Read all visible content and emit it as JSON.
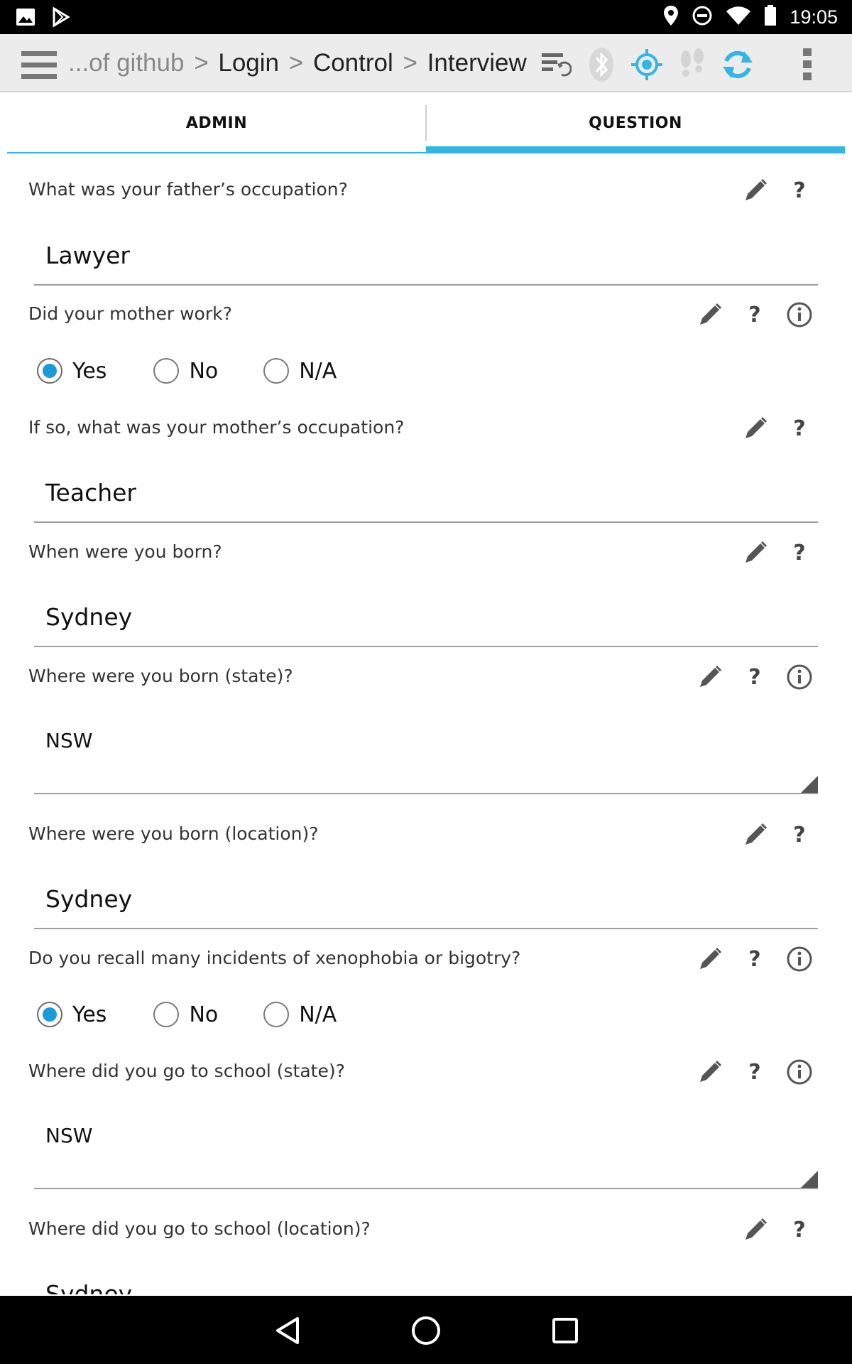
{
  "status_bar": {
    "time": "19:05",
    "icons": [
      "image-icon",
      "play-store-icon",
      "location-icon",
      "do-not-disturb-icon",
      "wifi-icon",
      "battery-icon"
    ]
  },
  "action_bar": {
    "breadcrumb_prefix": "...of github",
    "breadcrumb_sep": ">",
    "crumbs": [
      "Login",
      "Control",
      "Interview"
    ],
    "icons": [
      "sync-settings-icon",
      "bluetooth-icon",
      "gps-icon",
      "footsteps-icon",
      "refresh-icon",
      "overflow-menu-icon"
    ],
    "accent_color": "#33b5e5"
  },
  "tabs": [
    {
      "label": "ADMIN",
      "selected": false
    },
    {
      "label": "QUESTION",
      "selected": true
    }
  ],
  "questions": [
    {
      "label": "What was your father’s occupation?",
      "type": "text",
      "value": "Lawyer",
      "info": false
    },
    {
      "label": "Did your mother work?",
      "type": "radio",
      "options": [
        "Yes",
        "No",
        "N/A"
      ],
      "selected": "Yes",
      "info": true
    },
    {
      "label": "If so, what was your mother’s occupation?",
      "type": "text",
      "value": "Teacher",
      "info": false
    },
    {
      "label": "When were you born?",
      "type": "text",
      "value": "Sydney",
      "info": false
    },
    {
      "label": "Where were you born (state)?",
      "type": "select",
      "value": "NSW",
      "info": true
    },
    {
      "label": "Where were you born (location)?",
      "type": "text",
      "value": "Sydney",
      "info": false
    },
    {
      "label": "Do you recall many incidents of xenophobia or bigotry?",
      "type": "radio",
      "options": [
        "Yes",
        "No",
        "N/A"
      ],
      "selected": "Yes",
      "info": true
    },
    {
      "label": "Where did you go to school (state)?",
      "type": "select",
      "value": "NSW",
      "info": true
    },
    {
      "label": "Where did you go to school (location)?",
      "type": "text",
      "value": "Sydney",
      "info": false
    }
  ],
  "help_glyph": "?",
  "nav_bar": [
    "back-icon",
    "home-icon",
    "recents-icon"
  ]
}
